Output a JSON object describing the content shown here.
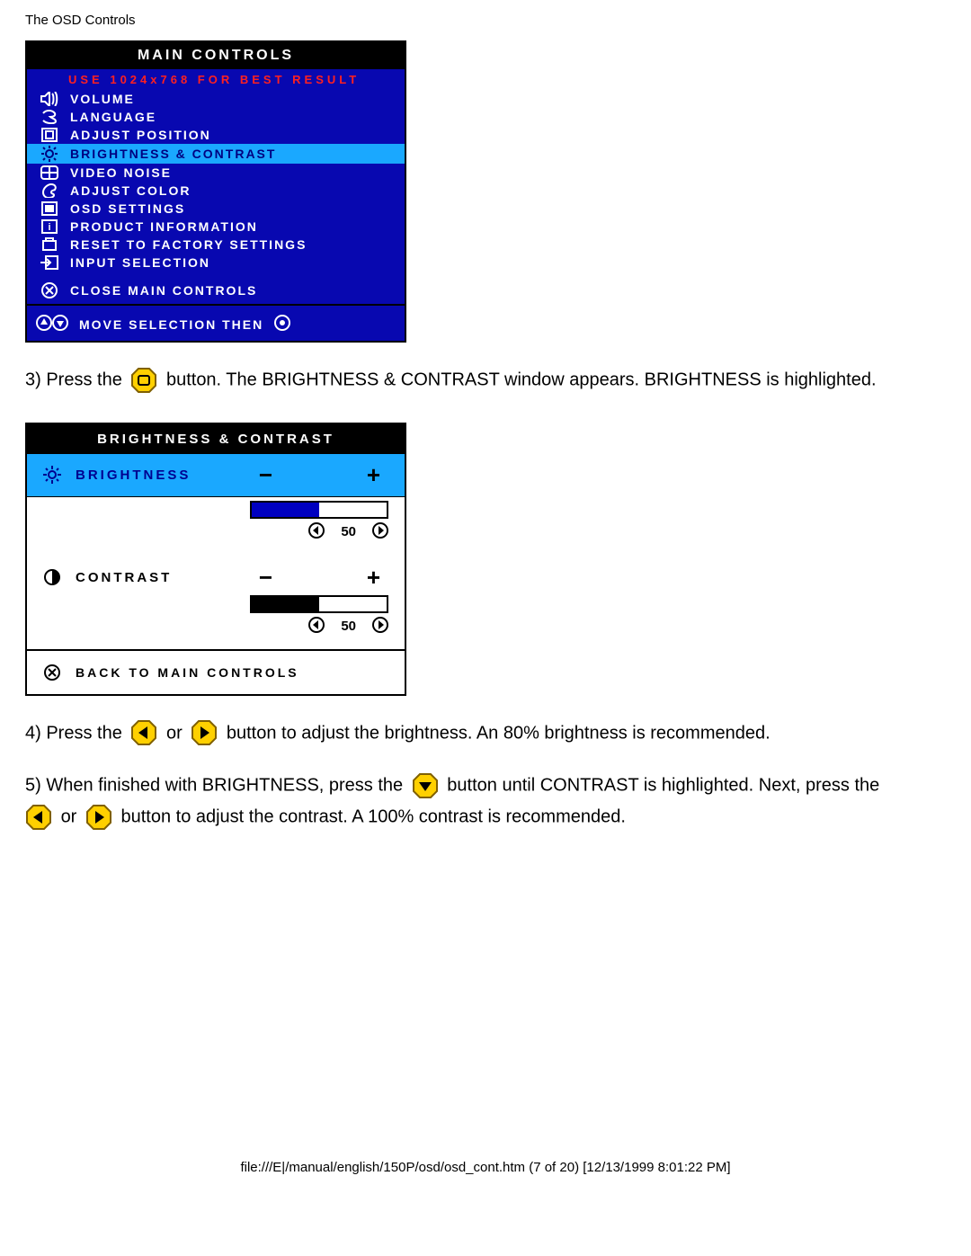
{
  "page": {
    "header": "The OSD Controls",
    "footer_path": "file:///E|/manual/english/150P/osd/osd_cont.htm (7 of 20) [12/13/1999 8:01:22 PM]"
  },
  "osd_main": {
    "title": "MAIN CONTROLS",
    "notice": "USE 1024x768 FOR BEST RESULT",
    "items": [
      {
        "icon": "volume-icon",
        "label": "VOLUME"
      },
      {
        "icon": "language-icon",
        "label": "LANGUAGE"
      },
      {
        "icon": "position-icon",
        "label": "ADJUST POSITION"
      },
      {
        "icon": "brightness-icon",
        "label": "BRIGHTNESS & CONTRAST",
        "selected": true
      },
      {
        "icon": "noise-icon",
        "label": "VIDEO NOISE"
      },
      {
        "icon": "color-icon",
        "label": "ADJUST COLOR"
      },
      {
        "icon": "osd-settings-icon",
        "label": "OSD SETTINGS"
      },
      {
        "icon": "info-icon",
        "label": "PRODUCT INFORMATION"
      },
      {
        "icon": "reset-icon",
        "label": "RESET TO FACTORY SETTINGS"
      },
      {
        "icon": "input-icon",
        "label": "INPUT SELECTION"
      }
    ],
    "close_label": "CLOSE MAIN CONTROLS",
    "footer_hint": "MOVE SELECTION THEN"
  },
  "bc_panel": {
    "title": "BRIGHTNESS & CONTRAST",
    "brightness": {
      "label": "BRIGHTNESS",
      "value": "50",
      "fill_percent": 50
    },
    "contrast": {
      "label": "CONTRAST",
      "value": "50",
      "fill_percent": 50
    },
    "back_label": "BACK TO MAIN CONTROLS",
    "minus": "−",
    "plus": "+"
  },
  "steps": {
    "s3a": "3) Press the ",
    "s3b": " button. The BRIGHTNESS & CONTRAST window appears. BRIGHTNESS is highlighted.",
    "s4a": "4) Press the ",
    "s4or": " or ",
    "s4b": " button to adjust the brightness. An 80% brightness is recommended.",
    "s5a": "5) When finished with BRIGHTNESS, press the ",
    "s5b": " button until CONTRAST is highlighted. Next, press the ",
    "s5or": " or ",
    "s5c": " button to adjust the contrast. A 100% contrast is recommended."
  }
}
